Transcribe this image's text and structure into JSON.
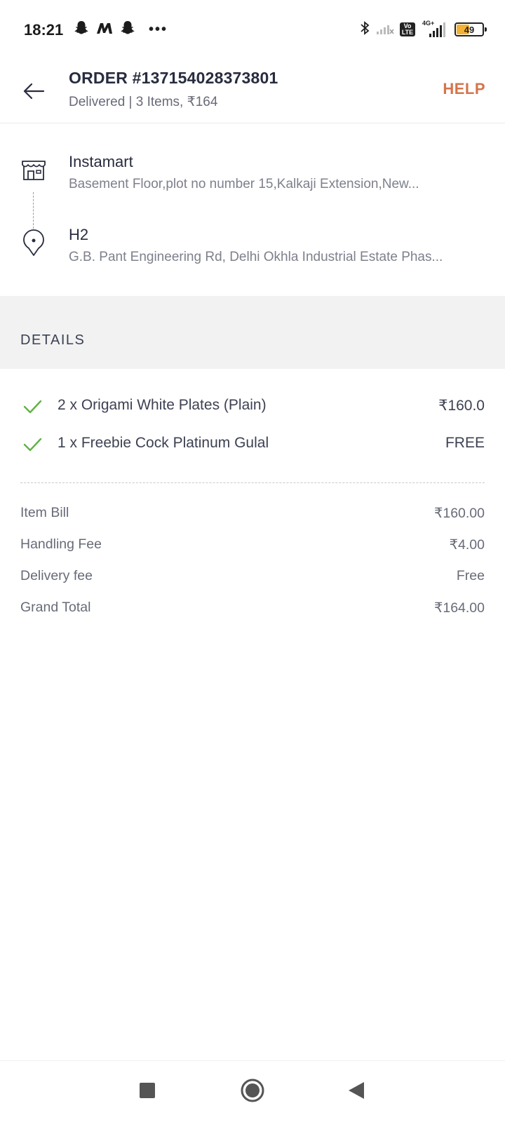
{
  "status_bar": {
    "time": "18:21",
    "dots": "•••",
    "volte_label": "Vo LTE",
    "network_label": "4G+",
    "battery": "49"
  },
  "header": {
    "order_title": "ORDER #137154028373801",
    "order_subtitle": "Delivered | 3 Items, ₹164",
    "help_label": "HELP"
  },
  "route": {
    "pickup": {
      "name": "Instamart",
      "address": "Basement Floor,plot no number 15,Kalkaji Extension,New..."
    },
    "drop": {
      "name": "H2",
      "address": "G.B. Pant Engineering Rd, Delhi Okhla Industrial Estate Phas..."
    }
  },
  "details": {
    "label": "DETAILS",
    "items": [
      {
        "name": "2 x Origami White Plates (Plain)",
        "price": "₹160.0"
      },
      {
        "name": "1 x Freebie Cock Platinum Gulal",
        "price": "FREE"
      }
    ]
  },
  "bill": [
    {
      "label": "Item Bill",
      "value": "₹160.00"
    },
    {
      "label": "Handling Fee",
      "value": "₹4.00"
    },
    {
      "label": "Delivery fee",
      "value": "Free"
    },
    {
      "label": "Grand Total",
      "value": "₹164.00"
    }
  ],
  "colors": {
    "accent": "#d5744b",
    "check": "#60b246",
    "text_primary": "#282c3f",
    "text_secondary": "#686b78",
    "band": "#f2f2f3"
  }
}
